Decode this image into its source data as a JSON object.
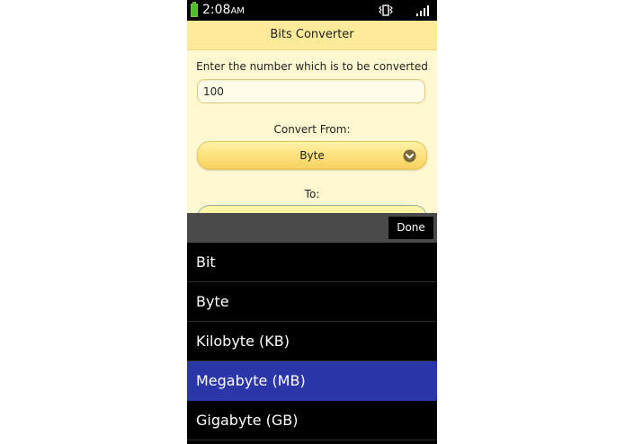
{
  "status_bar": {
    "time": "2:08",
    "ampm": "AM",
    "icons": [
      "battery-icon",
      "vibrate-icon",
      "signal-icon"
    ],
    "battery_color": "#4fbf2a"
  },
  "app": {
    "title": "Bits Converter",
    "prompt": "Enter the number which is to be converted",
    "number_value": "100",
    "from_label": "Convert From:",
    "from_value": "Byte",
    "to_label": "To:"
  },
  "picker": {
    "done_label": "Done",
    "selected_index": 3,
    "options": [
      {
        "label": "Bit"
      },
      {
        "label": "Byte"
      },
      {
        "label": "Kilobyte (KB)"
      },
      {
        "label": "Megabyte (MB)"
      },
      {
        "label": "Gigabyte (GB)"
      }
    ],
    "selected_color": "#2b36a8"
  },
  "colors": {
    "header_bg": "#fdeb99",
    "content_bg": "#fff8d0",
    "toolbar_bg": "#4a4a4a"
  }
}
